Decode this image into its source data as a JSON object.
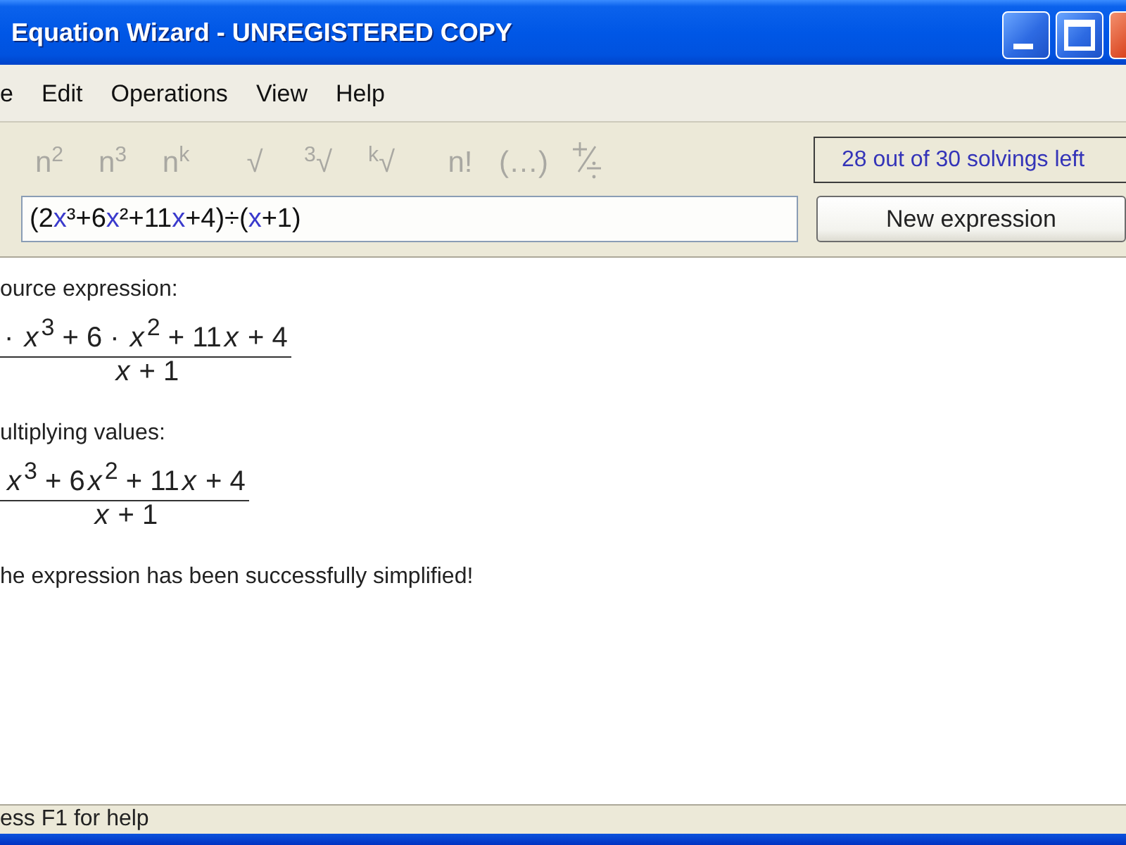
{
  "window": {
    "title": "Equation Wizard - UNREGISTERED COPY"
  },
  "menu": [
    {
      "label": "e"
    },
    {
      "label": "Edit"
    },
    {
      "label": "Operations"
    },
    {
      "label": "View"
    },
    {
      "label": "Help"
    }
  ],
  "toolbar": {
    "groups": [
      [
        {
          "kind": "text",
          "label": "n$^{2}$",
          "disabled": true
        },
        {
          "kind": "text",
          "label": "n$^{3}$",
          "disabled": true
        },
        {
          "kind": "text",
          "label": "n$^{k}$",
          "disabled": true
        }
      ],
      [
        {
          "kind": "text",
          "label": "√",
          "disabled": true
        },
        {
          "kind": "text",
          "label": "$^{3}$√",
          "disabled": true
        },
        {
          "kind": "text",
          "label": "$^{k}$√",
          "disabled": true
        }
      ],
      [
        {
          "kind": "text",
          "label": "n!",
          "disabled": true
        },
        {
          "kind": "text",
          "label": "(…)",
          "disabled": true
        },
        {
          "kind": "icon",
          "disabled": true
        }
      ]
    ],
    "counter": "28 out of 30 solvings left"
  },
  "expression": {
    "value": [
      {
        "kind": "number",
        "text": "(2"
      },
      {
        "kind": "variable",
        "text": "x"
      },
      {
        "kind": "number",
        "text": "³+6"
      },
      {
        "kind": "variable",
        "text": "x"
      },
      {
        "kind": "number",
        "text": "²+11"
      },
      {
        "kind": "variable",
        "text": "x"
      },
      {
        "kind": "number",
        "text": "+4)÷("
      },
      {
        "kind": "variable",
        "text": "x"
      },
      {
        "kind": "number",
        "text": "+1)"
      }
    ]
  },
  "new_expression_button": "New expression",
  "results": [
    {
      "label": "ource expression:",
      "numerator": [
        {
          "kind": "text",
          "text": "· "
        },
        {
          "kind": "variable",
          "text": "x"
        },
        {
          "kind": "power",
          "text": "3"
        },
        {
          "kind": "text",
          "text": " + 6 · "
        },
        {
          "kind": "variable",
          "text": "x"
        },
        {
          "kind": "power",
          "text": "2"
        },
        {
          "kind": "text",
          "text": " + 11"
        },
        {
          "kind": "variable",
          "text": "x"
        },
        {
          "kind": "text",
          "text": " + 4"
        }
      ],
      "denominator": [
        {
          "kind": "variable",
          "text": "x"
        },
        {
          "kind": "text",
          "text": " + 1"
        }
      ]
    },
    {
      "label": "ultiplying values:",
      "numerator": [
        {
          "kind": "variable",
          "text": "x"
        },
        {
          "kind": "power",
          "text": "3"
        },
        {
          "kind": "text",
          "text": " + 6"
        },
        {
          "kind": "variable",
          "text": "x"
        },
        {
          "kind": "power",
          "text": "2"
        },
        {
          "kind": "text",
          "text": " + 11"
        },
        {
          "kind": "variable",
          "text": "x"
        },
        {
          "kind": "text",
          "text": " + 4"
        }
      ],
      "denominator": [
        {
          "kind": "variable",
          "text": "x"
        },
        {
          "kind": "text",
          "text": " + 1"
        }
      ]
    }
  ],
  "message": "he expression has been successfully simplified!",
  "status_bar": "ess F1 for help"
}
